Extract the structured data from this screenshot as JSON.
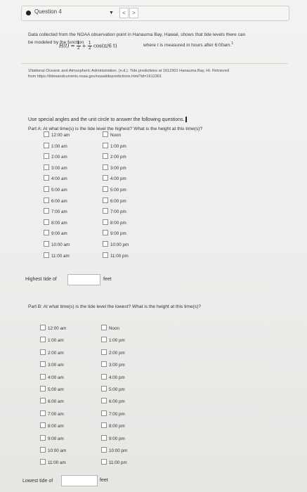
{
  "header": {
    "question_title": "Question 4",
    "nav_prev": "<",
    "nav_next": ">"
  },
  "prompt": {
    "line1": "Data collected from the NOAA observation point in Hanauma Bay, Hawaii, shows that tide levels there can",
    "line2_start": "be modeled by the function",
    "formula_lhs": "H(t) =",
    "formula_frac1_num": "1",
    "formula_frac1_den": "2",
    "formula_plus": "+",
    "formula_frac2_num": "1",
    "formula_frac2_den": "2",
    "formula_cos": "cos",
    "formula_arg": "(π/6 t)",
    "line2_end": "where t is measured in hours after 6:00am.",
    "footnote_ref": "1",
    "footnote_line1": "1National Oceanic and Atmospheric Administration. (n.d.). Tide predictions at 1612301 Hanauma Bay, HI. Retrieved",
    "footnote_line2": "from https://tidesandcurrents.noaa.gov/noaatidepredictions.html?id=1612301"
  },
  "instructions": "Use special angles and the unit circle to answer the following questions.",
  "part_a": {
    "question": "Part A: At what time(s) is the tide level the highest? What is the height at this time(s)?",
    "am_options": [
      "12:00 am",
      "1:00 am",
      "2:00 am",
      "3:00 am",
      "4:00 am",
      "5:00 am",
      "6:00 am",
      "7:00 am",
      "8:00 am",
      "9:00 am",
      "10:00 am",
      "11:00 am"
    ],
    "pm_options": [
      "Noon",
      "1:00 pm",
      "2:00 pm",
      "3:00 pm",
      "4:00 pm",
      "5:00 pm",
      "6:00 pm",
      "7:00 pm",
      "8:00 pm",
      "9:00 pm",
      "10:00 pm",
      "11:00 pm"
    ],
    "answer_label": "Highest tide of",
    "answer_value": "",
    "answer_unit": "feet"
  },
  "part_b": {
    "question": "Part B: At what time(s) is the tide level the lowest? What is the height at this time(s)?",
    "am_options": [
      "12:00 am",
      "1:00 am",
      "2:00 am",
      "3:00 am",
      "4:00 am",
      "5:00 am",
      "6:00 am",
      "7:00 am",
      "8:00 am",
      "9:00 am",
      "10:00 am",
      "11:00 am"
    ],
    "pm_options": [
      "Noon",
      "1:00 pm",
      "2:00 pm",
      "3:00 pm",
      "4:00 pm",
      "5:00 pm",
      "6:00 pm",
      "7:00 pm",
      "8:00 pm",
      "9:00 pm",
      "10:00 pm",
      "11:00 pm"
    ],
    "answer_label": "Lowest tide of",
    "answer_value": "",
    "answer_unit": "feet"
  }
}
